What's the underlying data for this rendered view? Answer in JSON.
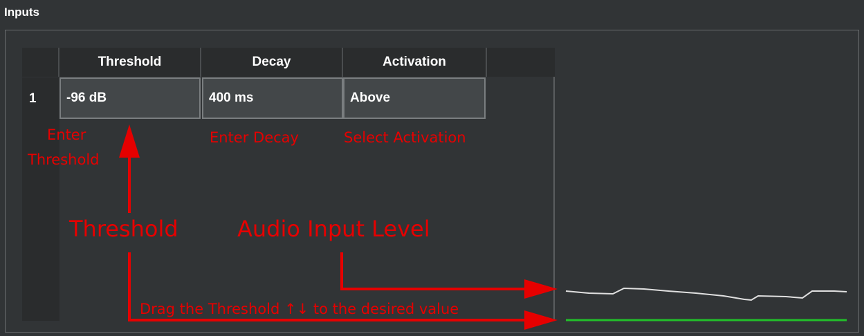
{
  "panel": {
    "title": "Inputs"
  },
  "table": {
    "columns": [
      "Threshold",
      "Decay",
      "Activation"
    ],
    "rows": [
      {
        "index": "1",
        "threshold": "-96 dB",
        "decay": "400 ms",
        "activation": "Above"
      }
    ]
  },
  "annotations": {
    "enter_threshold": "Enter Threshold",
    "enter_threshold_line1": "Enter",
    "enter_threshold_line2": "Threshold",
    "enter_decay": "Enter Decay",
    "select_activation": "Select Activation",
    "threshold": "Threshold",
    "audio_input_level": "Audio Input Level",
    "drag_hint": "Drag the Threshold ↑↓ to the desired value"
  },
  "colors": {
    "annotation": "#e60000",
    "level_line": "#e0e0e0",
    "threshold_line": "#22c02a"
  }
}
